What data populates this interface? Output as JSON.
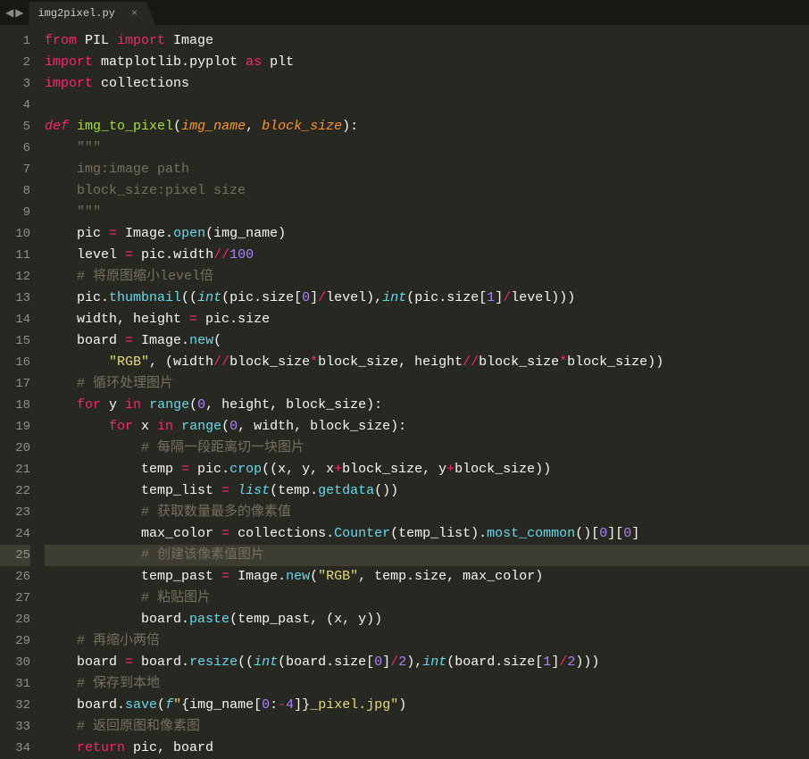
{
  "tab": {
    "filename": "img2pixel.py",
    "close": "×"
  },
  "nav": {
    "left": "◀",
    "right": "▶"
  },
  "highlight_line": 25,
  "lines": [
    {
      "n": 1,
      "t": [
        [
          "kw",
          "from"
        ],
        [
          "p",
          " PIL "
        ],
        [
          "kw",
          "import"
        ],
        [
          "p",
          " Image"
        ]
      ]
    },
    {
      "n": 2,
      "t": [
        [
          "kw",
          "import"
        ],
        [
          "p",
          " matplotlib"
        ],
        [
          "p",
          "."
        ],
        [
          "p",
          "pyplot "
        ],
        [
          "kw",
          "as"
        ],
        [
          "p",
          " plt"
        ]
      ]
    },
    {
      "n": 3,
      "t": [
        [
          "kw",
          "import"
        ],
        [
          "p",
          " collections"
        ]
      ]
    },
    {
      "n": 4,
      "t": [
        [
          "p",
          ""
        ]
      ]
    },
    {
      "n": 5,
      "t": [
        [
          "kw-it",
          "def"
        ],
        [
          "p",
          " "
        ],
        [
          "name",
          "img_to_pixel"
        ],
        [
          "p",
          "("
        ],
        [
          "param",
          "img_name"
        ],
        [
          "p",
          ", "
        ],
        [
          "param",
          "block_size"
        ],
        [
          "p",
          "):"
        ]
      ]
    },
    {
      "n": 6,
      "t": [
        [
          "p",
          "    "
        ],
        [
          "cmt",
          "\"\"\""
        ]
      ]
    },
    {
      "n": 7,
      "t": [
        [
          "p",
          "    "
        ],
        [
          "cmt",
          "img:image path"
        ]
      ]
    },
    {
      "n": 8,
      "t": [
        [
          "p",
          "    "
        ],
        [
          "cmt",
          "block_size:pixel size"
        ]
      ]
    },
    {
      "n": 9,
      "t": [
        [
          "p",
          "    "
        ],
        [
          "cmt",
          "\"\"\""
        ]
      ]
    },
    {
      "n": 10,
      "t": [
        [
          "p",
          "    pic "
        ],
        [
          "op",
          "="
        ],
        [
          "p",
          " Image"
        ],
        [
          "p",
          "."
        ],
        [
          "func",
          "open"
        ],
        [
          "p",
          "(img_name)"
        ]
      ]
    },
    {
      "n": 11,
      "t": [
        [
          "p",
          "    level "
        ],
        [
          "op",
          "="
        ],
        [
          "p",
          " pic"
        ],
        [
          "p",
          "."
        ],
        [
          "p",
          "width"
        ],
        [
          "op",
          "//"
        ],
        [
          "num",
          "100"
        ]
      ]
    },
    {
      "n": 12,
      "t": [
        [
          "p",
          "    "
        ],
        [
          "cmt",
          "# 将原图缩小level倍"
        ]
      ]
    },
    {
      "n": 13,
      "t": [
        [
          "p",
          "    pic"
        ],
        [
          "p",
          "."
        ],
        [
          "func",
          "thumbnail"
        ],
        [
          "p",
          "(("
        ],
        [
          "type",
          "int"
        ],
        [
          "p",
          "(pic"
        ],
        [
          "p",
          "."
        ],
        [
          "p",
          "size["
        ],
        [
          "num",
          "0"
        ],
        [
          "p",
          "]"
        ],
        [
          "op",
          "/"
        ],
        [
          "p",
          "level),"
        ],
        [
          "type",
          "int"
        ],
        [
          "p",
          "(pic"
        ],
        [
          "p",
          "."
        ],
        [
          "p",
          "size["
        ],
        [
          "num",
          "1"
        ],
        [
          "p",
          "]"
        ],
        [
          "op",
          "/"
        ],
        [
          "p",
          "level)))"
        ]
      ]
    },
    {
      "n": 14,
      "t": [
        [
          "p",
          "    width, height "
        ],
        [
          "op",
          "="
        ],
        [
          "p",
          " pic"
        ],
        [
          "p",
          "."
        ],
        [
          "p",
          "size"
        ]
      ]
    },
    {
      "n": 15,
      "t": [
        [
          "p",
          "    board "
        ],
        [
          "op",
          "="
        ],
        [
          "p",
          " Image"
        ],
        [
          "p",
          "."
        ],
        [
          "func",
          "new"
        ],
        [
          "p",
          "("
        ]
      ]
    },
    {
      "n": 16,
      "t": [
        [
          "p",
          "        "
        ],
        [
          "str",
          "\"RGB\""
        ],
        [
          "p",
          ", (width"
        ],
        [
          "op",
          "//"
        ],
        [
          "p",
          "block_size"
        ],
        [
          "op",
          "*"
        ],
        [
          "p",
          "block_size, height"
        ],
        [
          "op",
          "//"
        ],
        [
          "p",
          "block_size"
        ],
        [
          "op",
          "*"
        ],
        [
          "p",
          "block_size))"
        ]
      ]
    },
    {
      "n": 17,
      "t": [
        [
          "p",
          "    "
        ],
        [
          "cmt",
          "# 循环处理图片"
        ]
      ]
    },
    {
      "n": 18,
      "t": [
        [
          "p",
          "    "
        ],
        [
          "kw",
          "for"
        ],
        [
          "p",
          " y "
        ],
        [
          "kw",
          "in"
        ],
        [
          "p",
          " "
        ],
        [
          "func",
          "range"
        ],
        [
          "p",
          "("
        ],
        [
          "num",
          "0"
        ],
        [
          "p",
          ", height, block_size):"
        ]
      ]
    },
    {
      "n": 19,
      "t": [
        [
          "p",
          "        "
        ],
        [
          "kw",
          "for"
        ],
        [
          "p",
          " x "
        ],
        [
          "kw",
          "in"
        ],
        [
          "p",
          " "
        ],
        [
          "func",
          "range"
        ],
        [
          "p",
          "("
        ],
        [
          "num",
          "0"
        ],
        [
          "p",
          ", width, block_size):"
        ]
      ]
    },
    {
      "n": 20,
      "t": [
        [
          "p",
          "            "
        ],
        [
          "cmt",
          "# 每隔一段距离切一块图片"
        ]
      ]
    },
    {
      "n": 21,
      "t": [
        [
          "p",
          "            temp "
        ],
        [
          "op",
          "="
        ],
        [
          "p",
          " pic"
        ],
        [
          "p",
          "."
        ],
        [
          "func",
          "crop"
        ],
        [
          "p",
          "((x, y, x"
        ],
        [
          "op",
          "+"
        ],
        [
          "p",
          "block_size, y"
        ],
        [
          "op",
          "+"
        ],
        [
          "p",
          "block_size))"
        ]
      ]
    },
    {
      "n": 22,
      "t": [
        [
          "p",
          "            temp_list "
        ],
        [
          "op",
          "="
        ],
        [
          "p",
          " "
        ],
        [
          "type",
          "list"
        ],
        [
          "p",
          "(temp"
        ],
        [
          "p",
          "."
        ],
        [
          "func",
          "getdata"
        ],
        [
          "p",
          "())"
        ]
      ]
    },
    {
      "n": 23,
      "t": [
        [
          "p",
          "            "
        ],
        [
          "cmt",
          "# 获取数量最多的像素值"
        ]
      ]
    },
    {
      "n": 24,
      "t": [
        [
          "p",
          "            max_color "
        ],
        [
          "op",
          "="
        ],
        [
          "p",
          " collections"
        ],
        [
          "p",
          "."
        ],
        [
          "func",
          "Counter"
        ],
        [
          "p",
          "(temp_list)"
        ],
        [
          "p",
          "."
        ],
        [
          "func",
          "most_common"
        ],
        [
          "p",
          "()["
        ],
        [
          "num",
          "0"
        ],
        [
          "p",
          "]["
        ],
        [
          "num",
          "0"
        ],
        [
          "p",
          "]"
        ]
      ]
    },
    {
      "n": 25,
      "t": [
        [
          "p",
          "            "
        ],
        [
          "cmt",
          "# 创建该像素值图片"
        ]
      ]
    },
    {
      "n": 26,
      "t": [
        [
          "p",
          "            temp_past "
        ],
        [
          "op",
          "="
        ],
        [
          "p",
          " Image"
        ],
        [
          "p",
          "."
        ],
        [
          "func",
          "new"
        ],
        [
          "p",
          "("
        ],
        [
          "str",
          "\"RGB\""
        ],
        [
          "p",
          ", temp"
        ],
        [
          "p",
          "."
        ],
        [
          "p",
          "size, max_color)"
        ]
      ]
    },
    {
      "n": 27,
      "t": [
        [
          "p",
          "            "
        ],
        [
          "cmt",
          "# 粘贴图片"
        ]
      ]
    },
    {
      "n": 28,
      "t": [
        [
          "p",
          "            board"
        ],
        [
          "p",
          "."
        ],
        [
          "func",
          "paste"
        ],
        [
          "p",
          "(temp_past, (x, y))"
        ]
      ]
    },
    {
      "n": 29,
      "t": [
        [
          "p",
          "    "
        ],
        [
          "cmt",
          "# 再缩小两倍"
        ]
      ]
    },
    {
      "n": 30,
      "t": [
        [
          "p",
          "    board "
        ],
        [
          "op",
          "="
        ],
        [
          "p",
          " board"
        ],
        [
          "p",
          "."
        ],
        [
          "func",
          "resize"
        ],
        [
          "p",
          "(("
        ],
        [
          "type",
          "int"
        ],
        [
          "p",
          "(board"
        ],
        [
          "p",
          "."
        ],
        [
          "p",
          "size["
        ],
        [
          "num",
          "0"
        ],
        [
          "p",
          "]"
        ],
        [
          "op",
          "/"
        ],
        [
          "num",
          "2"
        ],
        [
          "p",
          "),"
        ],
        [
          "type",
          "int"
        ],
        [
          "p",
          "(board"
        ],
        [
          "p",
          "."
        ],
        [
          "p",
          "size["
        ],
        [
          "num",
          "1"
        ],
        [
          "p",
          "]"
        ],
        [
          "op",
          "/"
        ],
        [
          "num",
          "2"
        ],
        [
          "p",
          ")))"
        ]
      ]
    },
    {
      "n": 31,
      "t": [
        [
          "p",
          "    "
        ],
        [
          "cmt",
          "# 保存到本地"
        ]
      ]
    },
    {
      "n": 32,
      "t": [
        [
          "p",
          "    board"
        ],
        [
          "p",
          "."
        ],
        [
          "func",
          "save"
        ],
        [
          "p",
          "("
        ],
        [
          "type",
          "f"
        ],
        [
          "str",
          "\""
        ],
        [
          "p",
          "{img_name["
        ],
        [
          "num",
          "0"
        ],
        [
          "p",
          ":"
        ],
        [
          "op",
          "-"
        ],
        [
          "num",
          "4"
        ],
        [
          "p",
          "]}"
        ],
        [
          "str",
          "_pixel.jpg\""
        ],
        [
          "p",
          ")"
        ]
      ]
    },
    {
      "n": 33,
      "t": [
        [
          "p",
          "    "
        ],
        [
          "cmt",
          "# 返回原图和像素图"
        ]
      ]
    },
    {
      "n": 34,
      "t": [
        [
          "p",
          "    "
        ],
        [
          "kw",
          "return"
        ],
        [
          "p",
          " pic, board"
        ]
      ]
    }
  ]
}
